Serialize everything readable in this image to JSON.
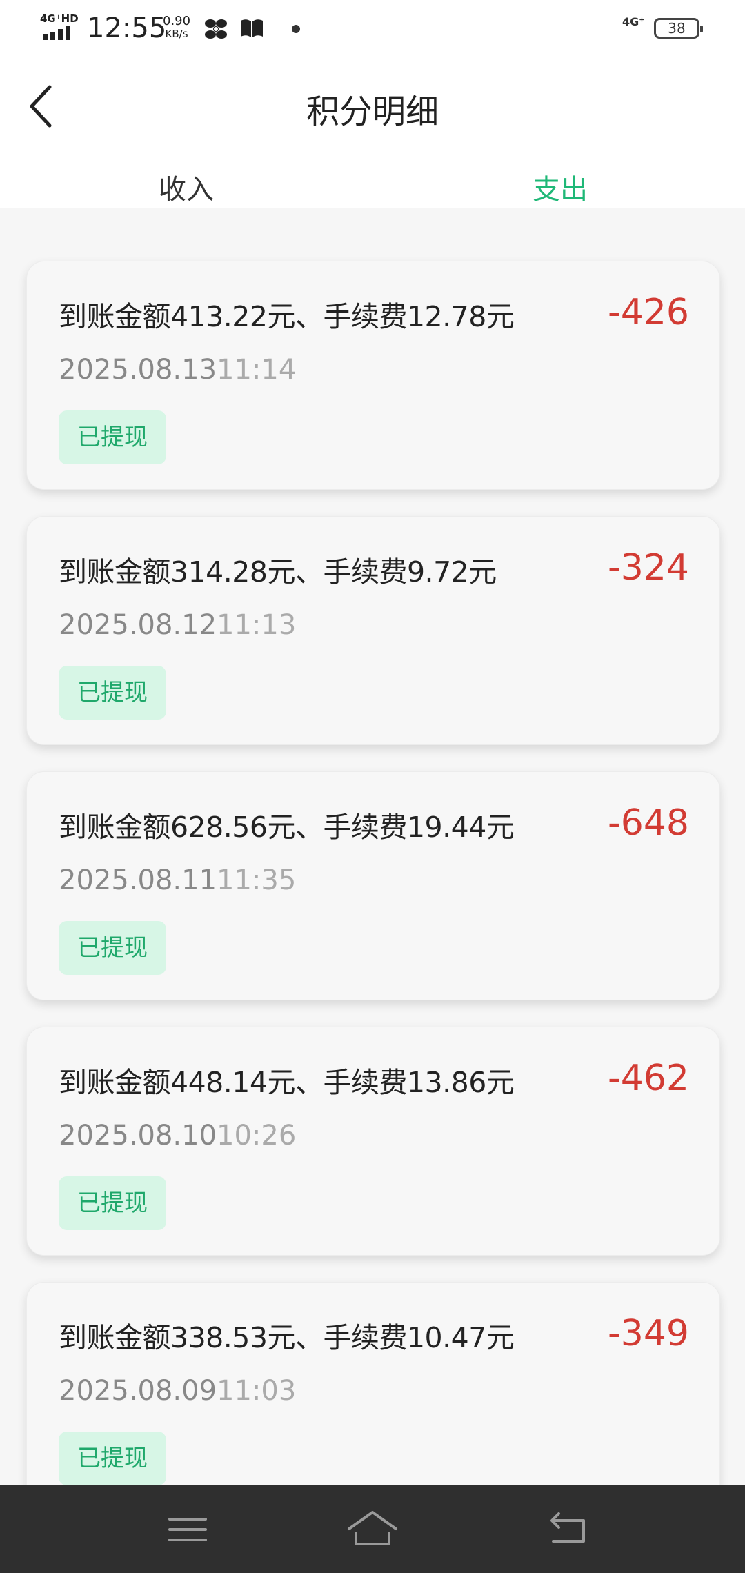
{
  "status_bar": {
    "network_label": "4G⁺HD",
    "time": "12:55",
    "speed_value": "0.90",
    "speed_unit": "KB/s",
    "network_type": "4G⁺",
    "battery": "38"
  },
  "header": {
    "title": "积分明细",
    "tabs": [
      {
        "label": "收入",
        "active": false
      },
      {
        "label": "支出",
        "active": true
      }
    ]
  },
  "colors": {
    "accent": "#1fb877",
    "amount_negative": "#d23b33",
    "badge_bg": "#d7f6e6"
  },
  "records": [
    {
      "description": "到账金额413.22元、手续费12.78元",
      "amount": "-426",
      "date": "2025.08.13",
      "time": "11:14",
      "status": "已提现"
    },
    {
      "description": "到账金额314.28元、手续费9.72元",
      "amount": "-324",
      "date": "2025.08.12",
      "time": "11:13",
      "status": "已提现"
    },
    {
      "description": "到账金额628.56元、手续费19.44元",
      "amount": "-648",
      "date": "2025.08.11",
      "time": "11:35",
      "status": "已提现"
    },
    {
      "description": "到账金额448.14元、手续费13.86元",
      "amount": "-462",
      "date": "2025.08.10",
      "time": "10:26",
      "status": "已提现"
    },
    {
      "description": "到账金额338.53元、手续费10.47元",
      "amount": "-349",
      "date": "2025.08.09",
      "time": "11:03",
      "status": "已提现"
    }
  ],
  "nav_bar": {
    "icons": [
      "menu-icon",
      "home-icon",
      "back-icon"
    ]
  }
}
